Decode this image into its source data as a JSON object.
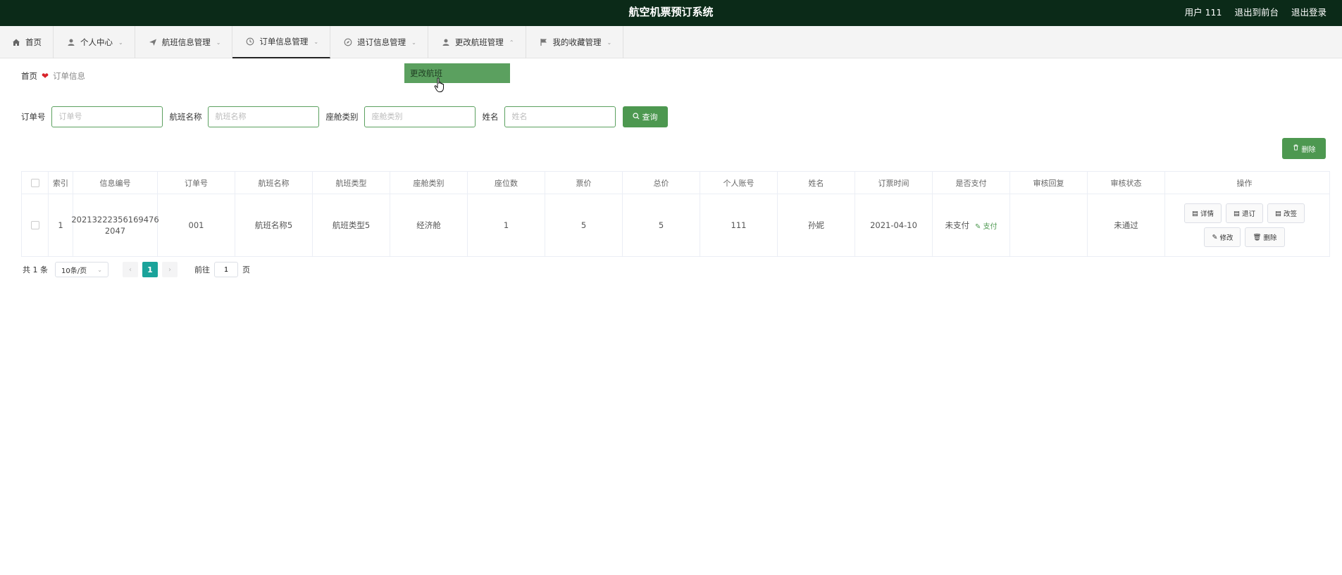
{
  "header": {
    "title": "航空机票预订系统",
    "user_label": "用户 111",
    "back_to_front": "退出到前台",
    "logout": "退出登录"
  },
  "nav": {
    "items": [
      {
        "label": "首页",
        "icon": "home-icon"
      },
      {
        "label": "个人中心",
        "icon": "user-icon"
      },
      {
        "label": "航班信息管理",
        "icon": "plane-icon"
      },
      {
        "label": "订单信息管理",
        "icon": "clock-icon"
      },
      {
        "label": "退订信息管理",
        "icon": "compass-icon"
      },
      {
        "label": "更改航班管理",
        "icon": "user-icon"
      },
      {
        "label": "我的收藏管理",
        "icon": "flag-icon"
      }
    ],
    "dropdown_item": "更改航班"
  },
  "breadcrumb": {
    "home": "首页",
    "current": "订单信息"
  },
  "search": {
    "order_no_label": "订单号",
    "order_no_placeholder": "订单号",
    "flight_name_label": "航班名称",
    "flight_name_placeholder": "航班名称",
    "cabin_label": "座舱类别",
    "cabin_placeholder": "座舱类别",
    "name_label": "姓名",
    "name_placeholder": "姓名",
    "query_button": "查询"
  },
  "delete_button": "删除",
  "table": {
    "headers": [
      "索引",
      "信息编号",
      "订单号",
      "航班名称",
      "航班类型",
      "座舱类别",
      "座位数",
      "票价",
      "总价",
      "个人账号",
      "姓名",
      "订票时间",
      "是否支付",
      "审核回复",
      "审核状态",
      "操作"
    ],
    "rows": [
      {
        "index": "1",
        "info_no_line1": "20213222356169476",
        "info_no_line2": "2047",
        "order_no": "001",
        "flight_name": "航班名称5",
        "flight_type": "航班类型5",
        "cabin": "经济舱",
        "seats": "1",
        "price": "5",
        "total": "5",
        "account": "111",
        "name": "孙妮",
        "order_time": "2021-04-10",
        "paid": "未支付",
        "pay_link": "支付",
        "review_reply": "",
        "review_status": "未通过",
        "ops": {
          "detail": "详情",
          "refund": "退订",
          "change": "改签",
          "edit": "修改",
          "delete": "删除"
        }
      }
    ]
  },
  "pagination": {
    "total": "共 1 条",
    "page_size": "10条/页",
    "current_page": "1",
    "goto_label": "前往",
    "goto_value": "1",
    "page_unit": "页"
  },
  "colors": {
    "header_bg": "#0b2a18",
    "accent_green": "#4d9850",
    "page_active": "#1aa39a"
  }
}
